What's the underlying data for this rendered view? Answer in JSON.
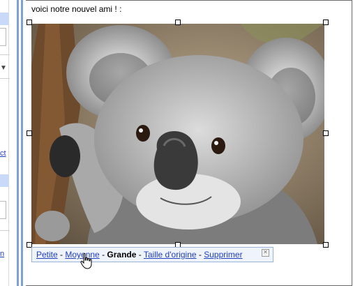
{
  "editor": {
    "body_text": "voici notre nouvel ami !",
    "trailing": " :"
  },
  "sidebar": {
    "link_1": "ct",
    "link_2": "n"
  },
  "size_options": {
    "small": "Petite",
    "medium": "Moyenne",
    "large": "Grande",
    "original": "Taille d'origine",
    "delete": "Supprimer",
    "separator": " - "
  },
  "icons": {
    "close": "close-icon",
    "cursor": "hand-cursor-icon",
    "dropdown": "chevron-down-icon"
  },
  "colors": {
    "link": "#1f3fbf",
    "frame": "#7f9fd8",
    "bar_bg": "#eef3fc",
    "bar_border": "#98b2d8"
  }
}
